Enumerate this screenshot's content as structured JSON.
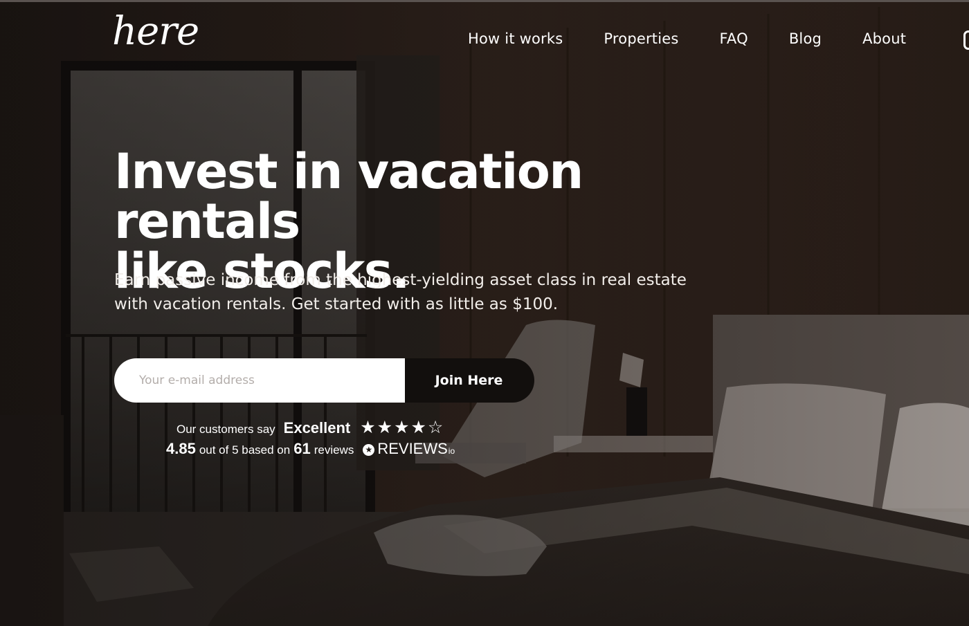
{
  "header": {
    "logo": "here",
    "nav": [
      "How it works",
      "Properties",
      "FAQ",
      "Blog",
      "About"
    ]
  },
  "hero": {
    "title_line1": "Invest in vacation rentals",
    "title_line2": "like stocks.",
    "subtitle": "Earn passive income from the highest-yielding asset class in real estate with vacation rentals. Get started with as little as $100."
  },
  "signup": {
    "email_placeholder": "Your e-mail address",
    "button_label": "Join Here"
  },
  "reviews": {
    "customers_say": "Our customers say",
    "rating_word": "Excellent",
    "stars": "★★★★☆",
    "stars_value": 4.85,
    "score": "4.85",
    "out_of": "out of 5 based on",
    "review_count": "61",
    "reviews_word": "reviews",
    "brand_icon": "★",
    "brand_name": "REVIEWS",
    "brand_suffix": "io"
  },
  "colors": {
    "background": "#1d1713",
    "button_bg": "#120f0d",
    "input_bg": "#ffffff",
    "text": "#ffffff"
  }
}
